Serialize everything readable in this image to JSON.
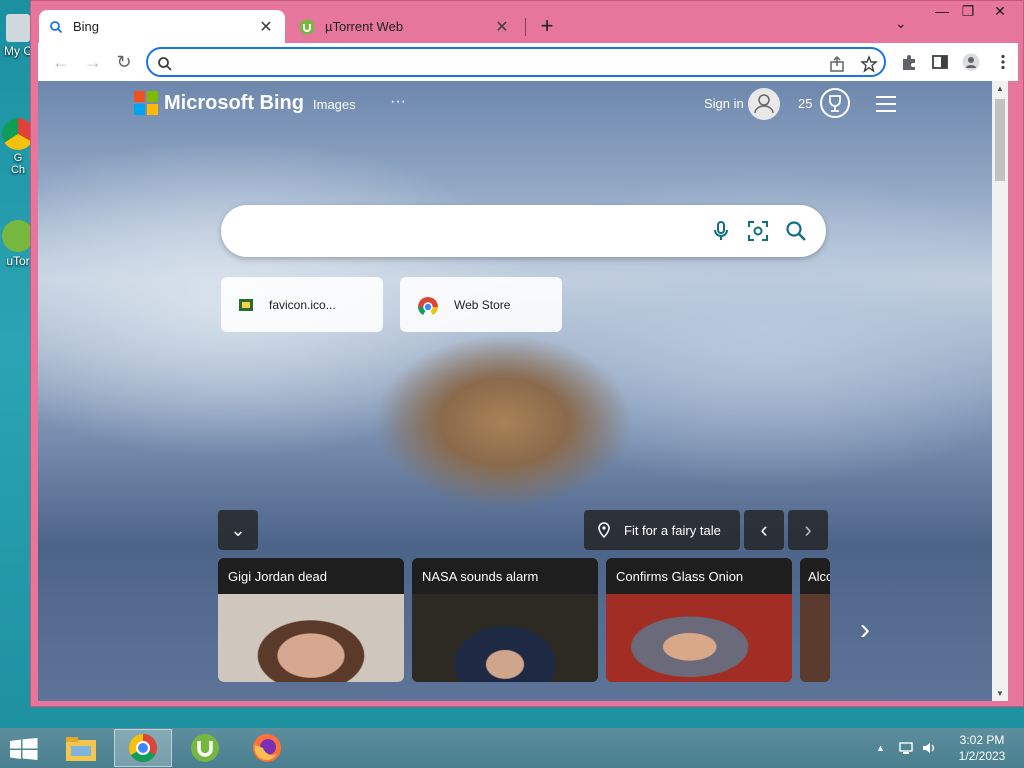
{
  "desktop": {
    "icons": [
      {
        "label": "My C",
        "icon": "computer-icon"
      },
      {
        "label": "G\nCh",
        "icon": "chrome-icon"
      },
      {
        "label": "uTor",
        "icon": "utorrent-icon"
      }
    ]
  },
  "browser": {
    "tabs": [
      {
        "title": "Bing",
        "icon": "bing-search-icon",
        "active": true
      },
      {
        "title": "µTorrent Web",
        "icon": "utorrent-icon",
        "active": false
      }
    ],
    "new_tab_label": "+",
    "tab_search_label": "⌄",
    "window_controls": {
      "minimize": "—",
      "maximize": "❐",
      "close": "✕"
    },
    "nav": {
      "back": "←",
      "forward": "→",
      "reload": "↻"
    },
    "omnibox": {
      "value": "",
      "placeholder": ""
    },
    "toolbar_icons": [
      "share-icon",
      "bookmark-star-icon",
      "extensions-icon",
      "side-panel-icon",
      "profile-icon",
      "menu-icon"
    ]
  },
  "bing": {
    "logo_text": "Microsoft Bing",
    "nav_images": "Images",
    "nav_more": "···",
    "sign_in": "Sign in",
    "rewards_count": "25",
    "search_placeholder": "",
    "quick_links": [
      {
        "label": "favicon.ico...",
        "icon": "favicon-file-icon"
      },
      {
        "label": "Web Store",
        "icon": "chrome-web-store-icon"
      }
    ],
    "image_caption": "Fit for a fairy tale",
    "collapse_label": "⌄",
    "prev_label": "‹",
    "next_label": "›",
    "news": [
      {
        "headline": "Gigi Jordan dead",
        "thumb_color": "#c9b6a8"
      },
      {
        "headline": "NASA sounds alarm",
        "thumb_color": "#2d2a24"
      },
      {
        "headline": "Confirms Glass Onion",
        "thumb_color": "#a12d24"
      },
      {
        "headline": "Alco",
        "thumb_color": "#5a3b2e"
      }
    ],
    "news_next": "›",
    "brand_colors": {
      "red": "#f25022",
      "green": "#7fba00",
      "blue": "#00a4ef",
      "yellow": "#ffb900"
    }
  },
  "taskbar": {
    "apps": [
      "file-explorer-icon",
      "chrome-icon",
      "utorrent-icon",
      "firefox-icon"
    ],
    "tray": {
      "chevron": "▲",
      "network": "network-icon",
      "volume": "volume-icon"
    },
    "time": "3:02 PM",
    "date": "1/2/2023"
  }
}
